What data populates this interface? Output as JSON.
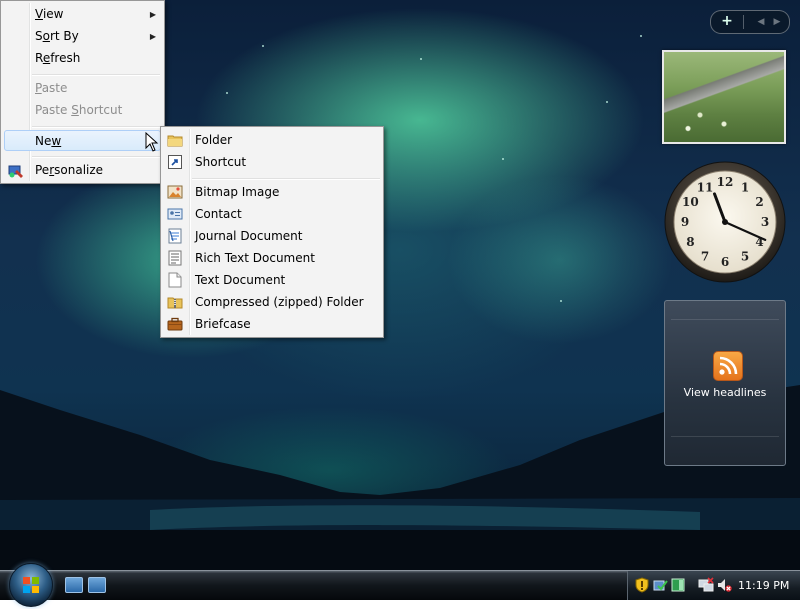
{
  "context_menu": {
    "items": [
      {
        "label": "View",
        "accel": "V",
        "has_submenu": true,
        "disabled": false
      },
      {
        "label": "Sort By",
        "accel": "o",
        "has_submenu": true,
        "disabled": false
      },
      {
        "label": "Refresh",
        "accel": "e",
        "has_submenu": false,
        "disabled": false
      },
      {
        "label": "Paste",
        "accel": "P",
        "has_submenu": false,
        "disabled": true
      },
      {
        "label": "Paste Shortcut",
        "accel": "S",
        "has_submenu": false,
        "disabled": true
      },
      {
        "label": "New",
        "accel": "w",
        "has_submenu": true,
        "disabled": false,
        "highlighted": true
      },
      {
        "label": "Personalize",
        "accel": "r",
        "has_submenu": false,
        "disabled": false,
        "icon": "personalize-icon"
      }
    ]
  },
  "new_submenu": {
    "items": [
      {
        "label": "Folder",
        "icon": "folder-icon"
      },
      {
        "label": "Shortcut",
        "icon": "shortcut-icon"
      },
      {
        "label": "Bitmap Image",
        "icon": "bitmap-icon"
      },
      {
        "label": "Contact",
        "icon": "contact-icon"
      },
      {
        "label": "Journal Document",
        "icon": "journal-icon"
      },
      {
        "label": "Rich Text Document",
        "icon": "rich-text-icon"
      },
      {
        "label": "Text Document",
        "icon": "text-document-icon"
      },
      {
        "label": "Compressed (zipped) Folder",
        "icon": "zip-folder-icon"
      },
      {
        "label": "Briefcase",
        "icon": "briefcase-icon"
      }
    ]
  },
  "sidebar": {
    "add_label": "+",
    "prev_label": "◀",
    "next_label": "▶",
    "clock": {
      "hour": 11,
      "minute": 19
    },
    "feed": {
      "label": "View headlines"
    }
  },
  "taskbar": {
    "time": "11:19 PM"
  }
}
